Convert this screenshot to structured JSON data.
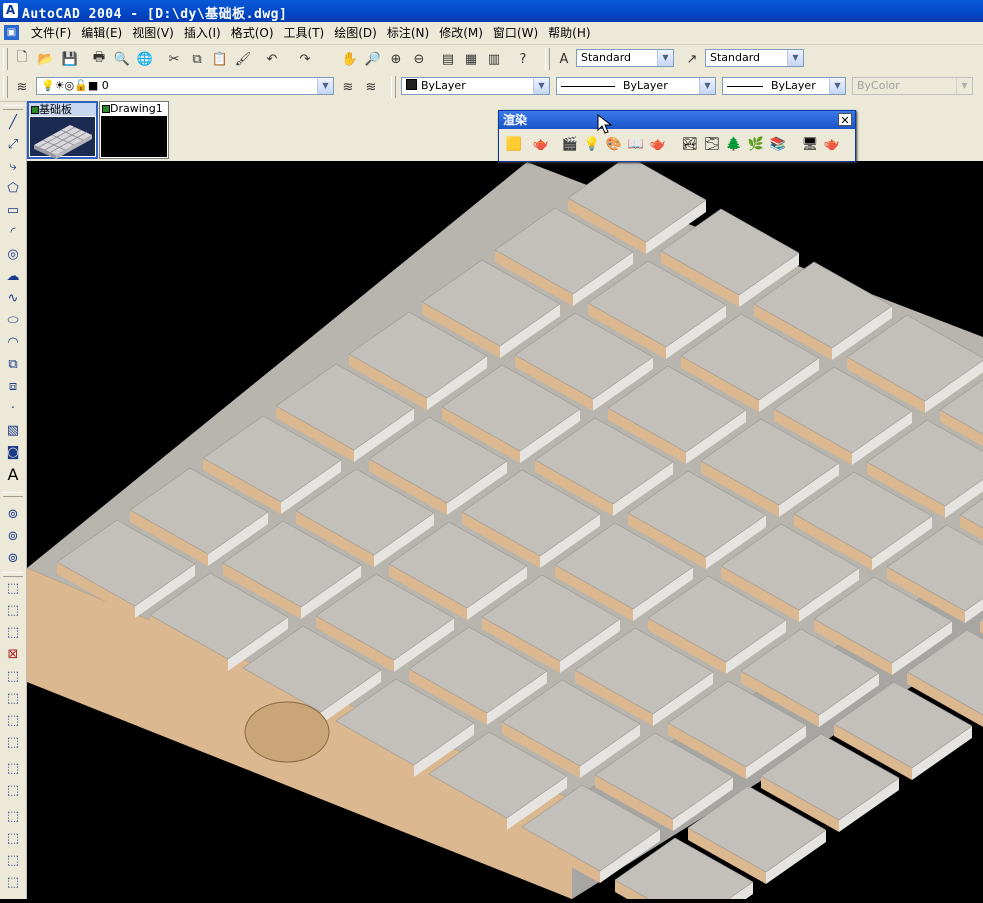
{
  "window": {
    "title": "AutoCAD 2004 - [D:\\dy\\基础板.dwg]",
    "app_icon": "A"
  },
  "menu": {
    "items": [
      "文件(F)",
      "编辑(E)",
      "视图(V)",
      "插入(I)",
      "格式(O)",
      "工具(T)",
      "绘图(D)",
      "标注(N)",
      "修改(M)",
      "窗口(W)",
      "帮助(H)"
    ]
  },
  "standard_toolbar": {
    "text_style": "Standard",
    "dim_style": "Standard"
  },
  "layers_toolbar": {
    "current_layer": "0",
    "color": "ByLayer",
    "linetype": "ByLayer",
    "lineweight": "ByLayer",
    "plot_style": "ByColor"
  },
  "tabs": [
    {
      "label": "基础板",
      "active": true
    },
    {
      "label": "Drawing1",
      "active": false
    }
  ],
  "render_toolbar": {
    "title": "渲染",
    "close": "✕"
  },
  "colors": {
    "slab_top": "#c3c0bc",
    "slab_side": "#dbb890",
    "background": "#000000"
  }
}
